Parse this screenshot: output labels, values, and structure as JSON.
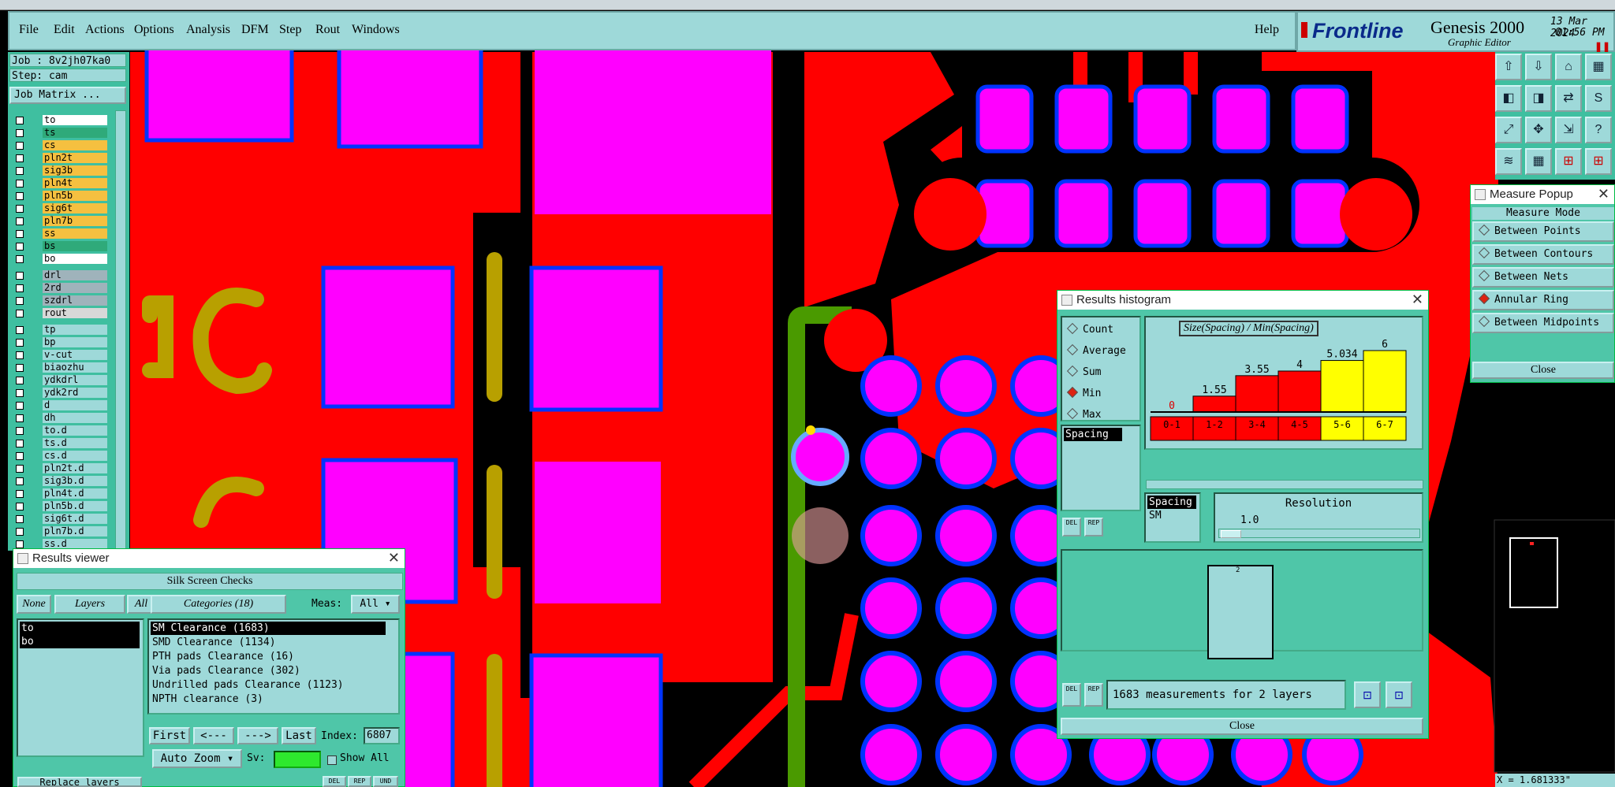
{
  "menubar": {
    "items": [
      "File",
      "Edit",
      "Actions",
      "Options",
      "Analysis",
      "DFM",
      "Step",
      "Rout",
      "Windows"
    ],
    "help": "Help"
  },
  "brand": {
    "logo": "Frontline",
    "product": "Genesis 2000",
    "subtitle": "Graphic Editor",
    "date": "13 Mar 2024",
    "time": "01:56 PM"
  },
  "left_panel": {
    "job": "Job : 8v2jh07ka0",
    "step": "Step: cam",
    "job_matrix": "Job Matrix ...",
    "layers": [
      {
        "name": "to",
        "color": "#ffffff"
      },
      {
        "name": "ts",
        "color": "#2faa7a"
      },
      {
        "name": "cs",
        "color": "#f5c040"
      },
      {
        "name": "pln2t",
        "color": "#f5c040"
      },
      {
        "name": "sig3b",
        "color": "#f5c040"
      },
      {
        "name": "pln4t",
        "color": "#f5c040"
      },
      {
        "name": "pln5b",
        "color": "#f5c040"
      },
      {
        "name": "sig6t",
        "color": "#f5c040"
      },
      {
        "name": "pln7b",
        "color": "#f5c040"
      },
      {
        "name": "ss",
        "color": "#f5c040"
      },
      {
        "name": "bs",
        "color": "#2faa7a"
      },
      {
        "name": "bo",
        "color": "#ffffff"
      },
      {
        "name": "drl",
        "color": "#9fb3bb"
      },
      {
        "name": "2rd",
        "color": "#9fb3bb"
      },
      {
        "name": "szdrl",
        "color": "#9fb3bb"
      },
      {
        "name": "rout",
        "color": "#d8d8d8"
      },
      {
        "name": "tp",
        "color": "#9ed9d9"
      },
      {
        "name": "bp",
        "color": "#9ed9d9"
      },
      {
        "name": "v-cut",
        "color": "#9ed9d9"
      },
      {
        "name": "biaozhu",
        "color": "#9ed9d9"
      },
      {
        "name": "ydkdrl",
        "color": "#9ed9d9"
      },
      {
        "name": "ydk2rd",
        "color": "#9ed9d9"
      },
      {
        "name": "d",
        "color": "#9ed9d9"
      },
      {
        "name": "dh",
        "color": "#9ed9d9"
      },
      {
        "name": "to.d",
        "color": "#9ed9d9"
      },
      {
        "name": "ts.d",
        "color": "#9ed9d9"
      },
      {
        "name": "cs.d",
        "color": "#9ed9d9"
      },
      {
        "name": "pln2t.d",
        "color": "#9ed9d9"
      },
      {
        "name": "sig3b.d",
        "color": "#9ed9d9"
      },
      {
        "name": "pln4t.d",
        "color": "#9ed9d9"
      },
      {
        "name": "pln5b.d",
        "color": "#9ed9d9"
      },
      {
        "name": "sig6t.d",
        "color": "#9ed9d9"
      },
      {
        "name": "pln7b.d",
        "color": "#9ed9d9"
      },
      {
        "name": "ss.d",
        "color": "#9ed9d9"
      }
    ],
    "replace_layers": "Replace layers"
  },
  "results_viewer": {
    "title": "Results viewer",
    "header": "Silk Screen Checks",
    "none_btn": "None",
    "layers_btn": "Layers",
    "all_btn": "All",
    "categories_btn": "Categories (18)",
    "meas_label": "Meas:",
    "meas_value": "All",
    "layer_list": [
      "to",
      "bo"
    ],
    "categories": [
      "SM Clearance (1683)",
      "SMD Clearance (1134)",
      "PTH pads Clearance (16)",
      "Via pads Clearance (302)",
      "Undrilled pads Clearance (1123)",
      "NPTH clearance (3)"
    ],
    "first_btn": "First",
    "prev_btn": "<---",
    "next_btn": "--->",
    "last_btn": "Last",
    "index_label": "Index:",
    "index_value": "6807",
    "auto_zoom": "Auto Zoom",
    "sv_label": "Sv:",
    "show_all": "Show All",
    "del_btn": "DEL",
    "rep_btn": "REP",
    "und_btn": "UND"
  },
  "histogram": {
    "title": "Results histogram",
    "modes": [
      {
        "label": "Count",
        "selected": false
      },
      {
        "label": "Average",
        "selected": false
      },
      {
        "label": "Sum",
        "selected": false
      },
      {
        "label": "Min",
        "selected": true
      },
      {
        "label": "Max",
        "selected": false
      }
    ],
    "chart_title": "Size(Spacing) / Min(Spacing)",
    "bins": [
      "0-1",
      "1-2",
      "3-4",
      "4-5",
      "5-6",
      "6-7"
    ],
    "values": [
      0,
      1.55,
      3.55,
      4,
      5.034,
      6
    ],
    "value_labels": [
      "0",
      "1.55",
      "3.55",
      "4",
      "5.034",
      "6"
    ],
    "bar_colors": [
      "#ff0000",
      "#ff0000",
      "#ff0000",
      "#ff0000",
      "#ffff00",
      "#ffff00"
    ],
    "list_left": "Spacing",
    "list2_a": "Spacing",
    "list2_b": "SM",
    "resolution_label": "Resolution",
    "resolution_value": "1.0",
    "preview_label": "2",
    "summary": "1683 measurements for 2 layers",
    "del_btn": "DEL",
    "rep_btn": "REP",
    "close": "Close"
  },
  "measure_popup": {
    "title": "Measure Popup",
    "mode_label": "Measure Mode",
    "modes": [
      {
        "label": "Between Points",
        "selected": false
      },
      {
        "label": "Between Contours",
        "selected": false
      },
      {
        "label": "Between Nets",
        "selected": false
      },
      {
        "label": "Annular Ring",
        "selected": true
      },
      {
        "label": "Between Midpoints",
        "selected": false
      }
    ],
    "close": "Close"
  },
  "canvas": {
    "component_label": "C1",
    "coord_readout": "X = 1.681333\""
  },
  "colors": {
    "copper": "#ff0000",
    "pad": "#ff00ff",
    "mask_edge": "#0033ff",
    "silk": "#b8a000",
    "panel": "#9ed9d9",
    "dialog": "#4fc6a8"
  }
}
